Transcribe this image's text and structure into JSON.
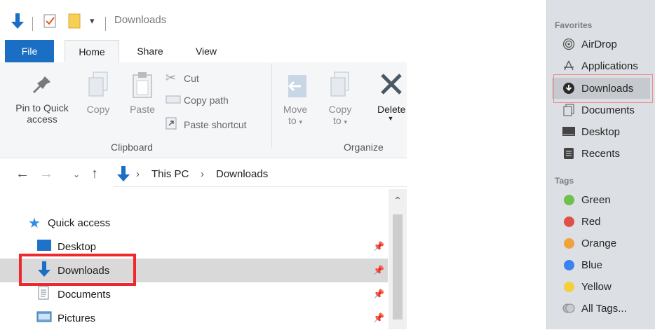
{
  "explorer": {
    "title": "Downloads",
    "tabs": {
      "file": "File",
      "home": "Home",
      "share": "Share",
      "view": "View"
    },
    "ribbon": {
      "pin_line1": "Pin to Quick",
      "pin_line2": "access",
      "copy": "Copy",
      "paste": "Paste",
      "cut": "Cut",
      "copy_path": "Copy path",
      "paste_shortcut": "Paste shortcut",
      "clipboard_group": "Clipboard",
      "move_to_line1": "Move",
      "move_to_line2": "to",
      "copy_to_line1": "Copy",
      "copy_to_line2": "to",
      "delete": "Delete",
      "organize_group": "Organize"
    },
    "address": {
      "this_pc": "This PC",
      "downloads": "Downloads"
    },
    "tree": {
      "quick_access": "Quick access",
      "items": [
        "Desktop",
        "Downloads",
        "Documents",
        "Pictures"
      ]
    },
    "accent": "#1a6ec4",
    "highlight_color": "#f0282d"
  },
  "finder": {
    "favorites_header": "Favorites",
    "favorites": [
      "AirDrop",
      "Applications",
      "Downloads",
      "Documents",
      "Desktop",
      "Recents"
    ],
    "tags_header": "Tags",
    "tags": [
      {
        "name": "Green",
        "color": "#6cc24a"
      },
      {
        "name": "Red",
        "color": "#e0504a"
      },
      {
        "name": "Orange",
        "color": "#efa33a"
      },
      {
        "name": "Blue",
        "color": "#3a82f0"
      },
      {
        "name": "Yellow",
        "color": "#f2d03a"
      }
    ],
    "all_tags": "All Tags...",
    "highlight_color": "#f08a8a"
  }
}
